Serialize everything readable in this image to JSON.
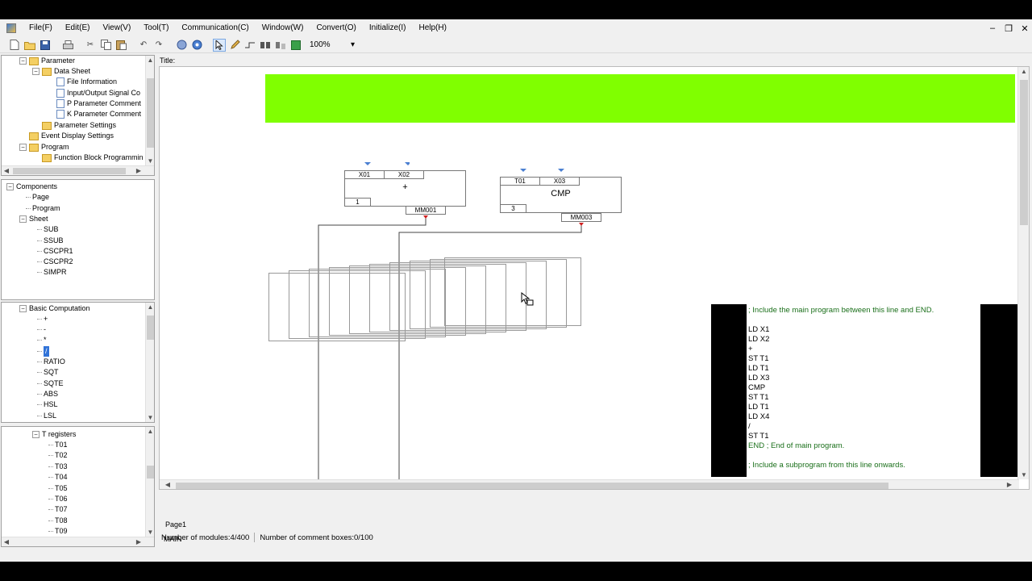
{
  "menu": [
    "File(F)",
    "Edit(E)",
    "View(V)",
    "Tool(T)",
    "Communication(C)",
    "Window(W)",
    "Convert(O)",
    "Initialize(I)",
    "Help(H)"
  ],
  "window_controls": {
    "minimize": "–",
    "restore": "❐",
    "close": "✕"
  },
  "toolbar": {
    "zoom": "100%"
  },
  "project_tree": {
    "items": [
      "Parameter",
      "Data Sheet",
      "File Information",
      "Input/Output Signal Co",
      "P Parameter Comment",
      "K Parameter Comment",
      "Parameter Settings",
      "Event Display Settings",
      "Program",
      "Function Block Programmin"
    ]
  },
  "components_tree": {
    "items": [
      "Components",
      "Page",
      "Program",
      "Sheet",
      "SUB",
      "SSUB",
      "CSCPR1",
      "CSCPR2",
      "SIMPR"
    ]
  },
  "computation_tree": {
    "items": [
      "Basic Computation",
      "+",
      "-",
      "*",
      "/",
      "RATIO",
      "SQT",
      "SQTE",
      "ABS",
      "HSL",
      "LSL"
    ]
  },
  "registers_tree": {
    "items": [
      "T registers",
      "T01",
      "T02",
      "T03",
      "T04",
      "T05",
      "T06",
      "T07",
      "T08",
      "T09"
    ]
  },
  "editor": {
    "title_label": "Title:",
    "block1": {
      "in1": "X01",
      "in2": "X02",
      "name": "+",
      "num": "1",
      "out": "MM001"
    },
    "block2": {
      "in1": "T01",
      "in2": "X03",
      "name": "CMP",
      "num": "3",
      "out": "MM003"
    },
    "code_lines": [
      "; Include the main program between this line and END.",
      "",
      "LD X1",
      "LD X2",
      "+",
      "ST T1",
      "LD T1",
      "LD X3",
      "CMP",
      "ST T1",
      "LD T1",
      "LD X4",
      "/",
      "ST T1",
      "END ; End of main program.",
      "",
      "; Include a subprogram from this line onwards."
    ],
    "sheet_tab": "Page1",
    "program_tab": "MAIN"
  },
  "status": {
    "modules": "Number of modules:4/400",
    "comment_boxes": "Number of comment boxes:0/100"
  },
  "colors": {
    "band": "#80ff00",
    "comment": "#1a6f1a"
  }
}
